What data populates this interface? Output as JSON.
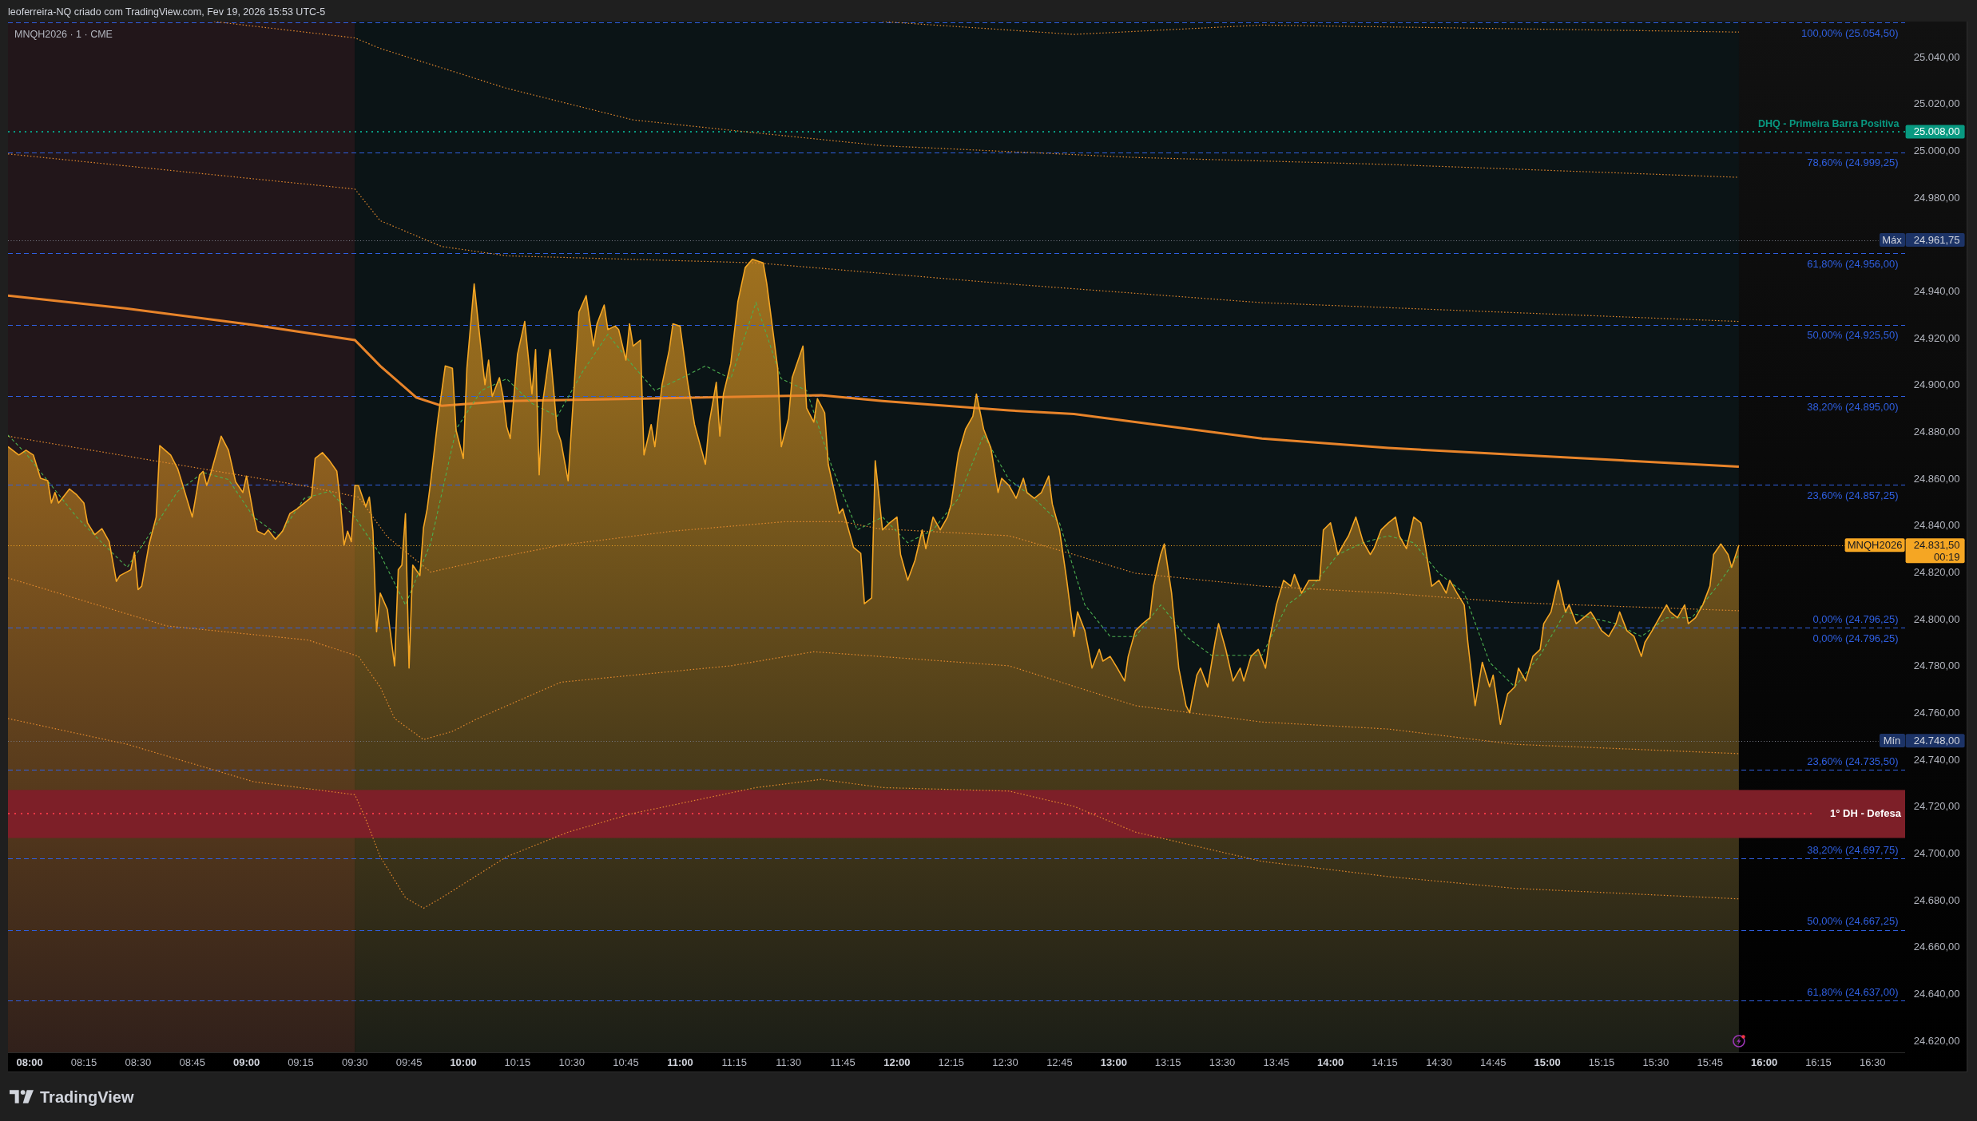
{
  "header": {
    "text": "leoferreira-NQ criado com TradingView.com, Fev 19, 2026 15:53 UTC-5"
  },
  "chart": {
    "legend": "MNQH2026 · 1 · CME",
    "last_price_tag": {
      "price": "24.831,50",
      "countdown": "00:19"
    },
    "chart_data": {
      "type": "area",
      "xlim": [
        474,
        999
      ],
      "ylim": [
        24615,
        25055
      ],
      "xticks": [
        {
          "value": 480,
          "label": "08:00"
        },
        {
          "value": 495,
          "label": "08:15"
        },
        {
          "value": 510,
          "label": "08:30"
        },
        {
          "value": 525,
          "label": "08:45"
        },
        {
          "value": 540,
          "label": "09:00"
        },
        {
          "value": 555,
          "label": "09:15"
        },
        {
          "value": 570,
          "label": "09:30"
        },
        {
          "value": 585,
          "label": "09:45"
        },
        {
          "value": 600,
          "label": "10:00"
        },
        {
          "value": 615,
          "label": "10:15"
        },
        {
          "value": 630,
          "label": "10:30"
        },
        {
          "value": 645,
          "label": "10:45"
        },
        {
          "value": 660,
          "label": "11:00"
        },
        {
          "value": 675,
          "label": "11:15"
        },
        {
          "value": 690,
          "label": "11:30"
        },
        {
          "value": 705,
          "label": "11:45"
        },
        {
          "value": 720,
          "label": "12:00"
        },
        {
          "value": 735,
          "label": "12:15"
        },
        {
          "value": 750,
          "label": "12:30"
        },
        {
          "value": 765,
          "label": "12:45"
        },
        {
          "value": 780,
          "label": "13:00"
        },
        {
          "value": 795,
          "label": "13:15"
        },
        {
          "value": 810,
          "label": "13:30"
        },
        {
          "value": 825,
          "label": "13:45"
        },
        {
          "value": 840,
          "label": "14:00"
        },
        {
          "value": 855,
          "label": "14:15"
        },
        {
          "value": 870,
          "label": "14:30"
        },
        {
          "value": 885,
          "label": "14:45"
        },
        {
          "value": 900,
          "label": "15:00"
        },
        {
          "value": 915,
          "label": "15:15"
        },
        {
          "value": 930,
          "label": "15:30"
        },
        {
          "value": 945,
          "label": "15:45"
        },
        {
          "value": 960,
          "label": "16:00"
        },
        {
          "value": 975,
          "label": "16:15"
        },
        {
          "value": 990,
          "label": "16:30"
        }
      ],
      "yticks": [
        {
          "value": 25040,
          "label": "25.040,00"
        },
        {
          "value": 25020,
          "label": "25.020,00"
        },
        {
          "value": 25008,
          "label": "25.008,00"
        },
        {
          "value": 25000,
          "label": "25.000,00"
        },
        {
          "value": 24980,
          "label": "24.980,00"
        },
        {
          "value": 24961.75,
          "label": "24.961,75"
        },
        {
          "value": 24940,
          "label": "24.940,00"
        },
        {
          "value": 24920,
          "label": "24.920,00"
        },
        {
          "value": 24900,
          "label": "24.900,00"
        },
        {
          "value": 24880,
          "label": "24.880,00"
        },
        {
          "value": 24860,
          "label": "24.860,00"
        },
        {
          "value": 24840,
          "label": "24.840,00"
        },
        {
          "value": 24820,
          "label": "24.820,00"
        },
        {
          "value": 24800,
          "label": "24.800,00"
        },
        {
          "value": 24780,
          "label": "24.780,00"
        },
        {
          "value": 24760,
          "label": "24.760,00"
        },
        {
          "value": 24748,
          "label": "24.748,00"
        },
        {
          "value": 24740,
          "label": "24.740,00"
        },
        {
          "value": 24720,
          "label": "24.720,00"
        },
        {
          "value": 24700,
          "label": "24.700,00"
        },
        {
          "value": 24680,
          "label": "24.680,00"
        },
        {
          "value": 24660,
          "label": "24.660,00"
        },
        {
          "value": 24640,
          "label": "24.640,00"
        },
        {
          "value": 24620,
          "label": "24.620,00"
        }
      ],
      "series": [
        {
          "name": "MNQH2026",
          "type": "area",
          "color": "#f5a623",
          "x": [
            474,
            477,
            479,
            481,
            483,
            485,
            486,
            487,
            488,
            491,
            493,
            495,
            496,
            498,
            500,
            502,
            504,
            505,
            508,
            509,
            510,
            511,
            513,
            515,
            516,
            519,
            521,
            522,
            525,
            527,
            528,
            529,
            530,
            533,
            535,
            537,
            539,
            540,
            542,
            543,
            545,
            546,
            548,
            550,
            552,
            554,
            558,
            559,
            561,
            563,
            565,
            566,
            567,
            568,
            569,
            570,
            571,
            573,
            574,
            575,
            576,
            577,
            579,
            581,
            582,
            583,
            584,
            585,
            586,
            588,
            589,
            590,
            591,
            593,
            595,
            597,
            598,
            600,
            601,
            603,
            605,
            606,
            607,
            608,
            610,
            611,
            612,
            613,
            615,
            617,
            619,
            620,
            621,
            622,
            624,
            626,
            627,
            629,
            631,
            632,
            634,
            636,
            637,
            639,
            640,
            642,
            643,
            645,
            646,
            647,
            649,
            650,
            652,
            653,
            655,
            657,
            658,
            660,
            662,
            664,
            667,
            668,
            670,
            671,
            672,
            674,
            676,
            678,
            680,
            683,
            684,
            687,
            688,
            690,
            691,
            694,
            695,
            697,
            698,
            700,
            701,
            704,
            705,
            708,
            710,
            711,
            713,
            714,
            716,
            718,
            720,
            721,
            723,
            725,
            727,
            728,
            730,
            732,
            734,
            735,
            737,
            739,
            741,
            742,
            744,
            746,
            748,
            749,
            751,
            753,
            755,
            756,
            758,
            760,
            762,
            763,
            765,
            767,
            769,
            770,
            772,
            774,
            776,
            777,
            779,
            781,
            783,
            784,
            786,
            788,
            790,
            791,
            793,
            794,
            796,
            797,
            798,
            800,
            801,
            803,
            804,
            806,
            808,
            809,
            811,
            813,
            815,
            816,
            818,
            820,
            822,
            823,
            825,
            827,
            829,
            830,
            832,
            834,
            837,
            838,
            840,
            842,
            844,
            845,
            847,
            849,
            851,
            852,
            854,
            856,
            858,
            859,
            861,
            863,
            865,
            866,
            868,
            870,
            872,
            873,
            875,
            877,
            878,
            880,
            882,
            884,
            885,
            887,
            889,
            891,
            892,
            894,
            896,
            898,
            899,
            901,
            903,
            905,
            906,
            908,
            910,
            912,
            913,
            915,
            917,
            919,
            920,
            922,
            924,
            926,
            927,
            929,
            931,
            933,
            934,
            936,
            938,
            939,
            941,
            943,
            945,
            946,
            948,
            950,
            951,
            953
          ],
          "values": [
            24873.5,
            24870,
            24872,
            24870,
            24860,
            24859,
            24849.5,
            24854,
            24849.5,
            24855.5,
            24853,
            24849.5,
            24841,
            24836,
            24838.5,
            24833,
            24816,
            24818.5,
            24821,
            24828.5,
            24812.5,
            24814,
            24831.5,
            24843.5,
            24874,
            24870,
            24864,
            24859,
            24843.5,
            24861.5,
            24863,
            24857,
            24861.5,
            24878,
            24872,
            24858.5,
            24854,
            24861,
            24844,
            24837.5,
            24836,
            24838,
            24834,
            24837.5,
            24845,
            24847,
            24852,
            24868.5,
            24871,
            24867.5,
            24863,
            24849.5,
            24831.5,
            24837.5,
            24833,
            24857,
            24857,
            24848,
            24852,
            24837.5,
            24794.5,
            24811,
            24804,
            24780,
            24821,
            24823,
            24845,
            24779,
            24823,
            24818.5,
            24839,
            24847,
            24859,
            24885.5,
            24908,
            24907,
            24880.5,
            24868.5,
            24907,
            24943,
            24914,
            24900,
            24910.5,
            24895,
            24903,
            24895,
            24882,
            24877,
            24913,
            24927,
            24896,
            24915,
            24861.5,
            24892.5,
            24915,
            24880.5,
            24876,
            24859,
            24907,
            24931,
            24938,
            24916.5,
            24926,
            24934,
            24923.5,
            24925,
            24923.5,
            24910.5,
            24926,
            24916.5,
            24919,
            24870,
            24883,
            24873.5,
            24900,
            24915,
            24926,
            24925,
            24902,
            24883,
            24866,
            24883,
            24901,
            24878,
            24896,
            24909,
            24935.5,
            24950,
            24953.5,
            24952,
            24943,
            24907,
            24873.5,
            24885.5,
            24903,
            24916.5,
            24890,
            24884,
            24894,
            24888,
            24866,
            24845,
            24847,
            24830.5,
            24828,
            24806.5,
            24809,
            24867.5,
            24838,
            24841,
            24843.5,
            24827.5,
            24816.5,
            24825,
            24838,
            24830,
            24843.5,
            24838,
            24843.5,
            24849,
            24870.5,
            24881,
            24886.5,
            24896,
            24881,
            24873,
            24854,
            24860,
            24857,
            24851.5,
            24860,
            24854,
            24851.5,
            24854,
            24861,
            24849,
            24838,
            24816.5,
            24792.5,
            24803,
            24795,
            24779,
            24787,
            24782,
            24784,
            24779,
            24773.5,
            24784,
            24795,
            24798,
            24800.5,
            24814,
            24827.5,
            24832,
            24811,
            24795,
            24779,
            24763,
            24760,
            24776,
            24779,
            24771,
            24790,
            24798,
            24787,
            24773.5,
            24779,
            24773.5,
            24784,
            24787,
            24779,
            24790,
            24806,
            24816.5,
            24814,
            24819,
            24811,
            24816.5,
            24816.5,
            24838,
            24841,
            24827.5,
            24833,
            24835.5,
            24843.5,
            24833,
            24827.5,
            24830,
            24838,
            24841,
            24843.5,
            24835.5,
            24830,
            24843.5,
            24841,
            24833,
            24814,
            24816.5,
            24811,
            24816.5,
            24811,
            24806,
            24790,
            24763,
            24781.5,
            24771,
            24776,
            24755,
            24768,
            24771,
            24779,
            24773.5,
            24784,
            24787,
            24798,
            24803,
            24816.5,
            24803,
            24806,
            24798,
            24800.5,
            24803,
            24800.5,
            24795,
            24792.5,
            24798,
            24803,
            24795,
            24792.5,
            24784,
            24790,
            24795,
            24800.5,
            24806,
            24803,
            24800.5,
            24806,
            24798,
            24800.5,
            24806,
            24814,
            24827.5,
            24832,
            24827.5,
            24822,
            24831.5
          ]
        },
        {
          "type": "line",
          "line_style": "dotted",
          "color": "#e58a2e",
          "x": [
            716,
            769,
            821,
            953
          ],
          "values": [
            25055,
            25049.5,
            25053.5,
            25050.5
          ]
        },
        {
          "type": "line",
          "line_style": "dotted",
          "color": "#e58a2e",
          "x": [
            531,
            570,
            577,
            612,
            647,
            681,
            716,
            786,
            856,
            953
          ],
          "values": [
            25055,
            25048,
            25043.5,
            25026.5,
            25013,
            25007.5,
            25002,
            24997,
            24994,
            24988.5
          ]
        },
        {
          "type": "line",
          "line_style": "dotted",
          "color": "#e58a2e",
          "x": [
            474,
            570,
            577,
            594,
            612,
            681,
            751,
            821,
            953
          ],
          "values": [
            24998.5,
            24983.5,
            24970,
            24959,
            24955,
            24952,
            24943,
            24935,
            24927
          ]
        },
        {
          "type": "line",
          "line_style": "solid",
          "color": "#e8842a",
          "x": [
            474,
            507,
            542,
            570,
            577,
            587,
            594,
            612,
            647,
            681,
            699,
            716,
            751,
            769,
            821,
            856,
            953
          ],
          "values": [
            24938,
            24932.5,
            24925.5,
            24919,
            24908,
            24894.5,
            24891,
            24893,
            24894,
            24895,
            24895.5,
            24893,
            24889,
            24887.5,
            24877,
            24873,
            24865
          ]
        },
        {
          "type": "line",
          "line_style": "dotted",
          "color": "#e58a2e",
          "x": [
            474,
            557,
            571,
            579,
            591,
            604,
            627,
            658,
            689,
            705,
            715,
            751,
            769,
            786,
            821,
            856,
            891,
            953
          ],
          "values": [
            24878,
            24856.5,
            24852,
            24835,
            24820,
            24824.5,
            24831.5,
            24837.5,
            24841.5,
            24841.5,
            24838.5,
            24835.5,
            24827.5,
            24819.5,
            24814,
            24811,
            24807,
            24803.5
          ]
        },
        {
          "type": "line",
          "line_style": "dotted",
          "color": "#e58a2e",
          "x": [
            474,
            518,
            557,
            571,
            577,
            581,
            589,
            597,
            604,
            627,
            674,
            697,
            715,
            751,
            786,
            821,
            856,
            891,
            953
          ],
          "values": [
            24817.5,
            24797,
            24791,
            24784,
            24771,
            24757.5,
            24748.5,
            24752,
            24757.5,
            24773,
            24780,
            24786,
            24784,
            24780,
            24763,
            24756,
            24753,
            24746.5,
            24742.5
          ]
        },
        {
          "type": "line",
          "line_style": "dotted",
          "color": "#e58a2e",
          "x": [
            474,
            507,
            542,
            570,
            573,
            577,
            584,
            589,
            594,
            612,
            629,
            647,
            681,
            699,
            716,
            751,
            769,
            786,
            821,
            856,
            891,
            953
          ],
          "values": [
            24757.5,
            24746.5,
            24730.5,
            24725,
            24714.5,
            24698.5,
            24681,
            24676.5,
            24681,
            24698.5,
            24709,
            24717,
            24728,
            24731.5,
            24728,
            24726.5,
            24720,
            24709,
            24696.5,
            24690,
            24685,
            24680.5
          ]
        },
        {
          "type": "line",
          "line_style": "dashed",
          "color": "#4caf50",
          "x": [
            474,
            479,
            486,
            493,
            500,
            507,
            514,
            521,
            528,
            535,
            542,
            549,
            556,
            563,
            570,
            577,
            584,
            591,
            598,
            605,
            612,
            619,
            626,
            633,
            640,
            647,
            653,
            660,
            667,
            674,
            681,
            688,
            695,
            702,
            709,
            716,
            723,
            730,
            737,
            744,
            751,
            758,
            765,
            772,
            779,
            786,
            793,
            800,
            807,
            814,
            821,
            828,
            835,
            842,
            849,
            856,
            863,
            870,
            877,
            884,
            891,
            898,
            905,
            912,
            919,
            926,
            933,
            940,
            947,
            953
          ],
          "values": [
            24878.5,
            24870.5,
            24857,
            24843.5,
            24832.5,
            24822,
            24838,
            24854.5,
            24862.5,
            24859.5,
            24843.5,
            24835.5,
            24851.5,
            24854.5,
            24843.5,
            24827.5,
            24806,
            24832.5,
            24881,
            24897.5,
            24902.5,
            24892,
            24886.5,
            24905.5,
            24921.5,
            24908,
            24897.5,
            24902.5,
            24908,
            24902.5,
            24935,
            24902.5,
            24897.5,
            24865,
            24838,
            24843.5,
            24832.5,
            24838,
            24851.5,
            24878.5,
            24859.5,
            24851.5,
            24841,
            24806,
            24792.5,
            24792.5,
            24806,
            24792.5,
            24784.5,
            24784.5,
            24784.5,
            24806,
            24814,
            24827.5,
            24832.5,
            24835.5,
            24832.5,
            24819.5,
            24811,
            24781.5,
            24771,
            24784.5,
            24803,
            24800.5,
            24798,
            24792.5,
            24800.5,
            24800.5,
            24814,
            24827.5
          ]
        }
      ],
      "ref_lines": [
        {
          "axis": "y",
          "value": 25054.5,
          "label": "100,00% (25.054,50)",
          "color": "#2f5fe0",
          "line_style": "dashed"
        },
        {
          "axis": "y",
          "value": 25008,
          "label": "DHQ - Primeira Barra Positiva",
          "color": "#089981",
          "line_style": "dotted"
        },
        {
          "axis": "y",
          "value": 24999.25,
          "label": "78,60% (24.999,25)",
          "color": "#2f5fe0",
          "line_style": "dashed"
        },
        {
          "axis": "y",
          "value": 24961.75,
          "label": "Máx",
          "color": "#787b86",
          "line_style": "dotted"
        },
        {
          "axis": "y",
          "value": 24956,
          "label": "61,80% (24.956,00)",
          "color": "#2f5fe0",
          "line_style": "dashed"
        },
        {
          "axis": "y",
          "value": 24925.5,
          "label": "50,00% (24.925,50)",
          "color": "#2f5fe0",
          "line_style": "dashed"
        },
        {
          "axis": "y",
          "value": 24895,
          "label": "38,20% (24.895,00)",
          "color": "#2f5fe0",
          "line_style": "dashed"
        },
        {
          "axis": "y",
          "value": 24857.25,
          "label": "23,60% (24.857,25)",
          "color": "#2f5fe0",
          "line_style": "dashed"
        },
        {
          "axis": "y",
          "value": 24831.5,
          "color": "#f5a623",
          "line_style": "dotted"
        },
        {
          "axis": "y",
          "value": 24796.25,
          "color": "#2f5fe0",
          "line_style": "dashed"
        },
        {
          "axis": "y",
          "value": 24748,
          "label": "Mín",
          "color": "#787b86",
          "line_style": "dotted"
        },
        {
          "axis": "y",
          "value": 24735.5,
          "label": "23,60% (24.735,50)",
          "color": "#2f5fe0",
          "line_style": "dashed"
        },
        {
          "axis": "y",
          "value": 24717,
          "label": "1° DH - Defesa",
          "color": "#f23645",
          "line_style": "dotted"
        },
        {
          "axis": "y",
          "value": 24697.75,
          "label": "38,20% (24.697,75)",
          "color": "#2f5fe0",
          "line_style": "dashed"
        },
        {
          "axis": "y",
          "value": 24667.25,
          "label": "50,00% (24.667,25)",
          "color": "#2f5fe0",
          "line_style": "dashed"
        },
        {
          "axis": "y",
          "value": 24637,
          "label": "61,80% (24.637,00)",
          "color": "#2f5fe0",
          "line_style": "dashed"
        }
      ],
      "annotations": [
        "0,00% (24.796,25)",
        "0,00% (24.796,25)"
      ],
      "bands": [
        {
          "axis": "x",
          "from": 474,
          "to": 570,
          "color": "#22161a"
        },
        {
          "axis": "x",
          "from": 570,
          "to": 953,
          "color": "#0b1416"
        },
        {
          "axis": "y",
          "from": 24706.5,
          "to": 24727,
          "color": "#7d1f28"
        }
      ]
    }
  },
  "footer": {
    "brand": "TradingView"
  }
}
